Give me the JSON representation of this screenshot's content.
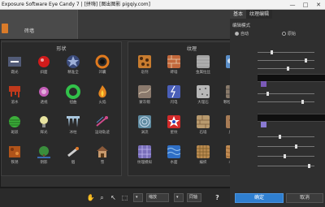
{
  "window": {
    "title": "Exposure Software Eye Candy 7 | [拼嗨] [图出图影 pigqiy.com]",
    "controls": [
      "—",
      "□",
      "✕"
    ]
  },
  "strip": {
    "label": "砖墙"
  },
  "left_panel": {
    "title": "形状",
    "items": [
      {
        "label": "霜光",
        "icon": "glow-icon",
        "color": "#7a8cc4"
      },
      {
        "label": "斜面",
        "icon": "sphere-icon",
        "color": "#d21b1b"
      },
      {
        "label": "精准全",
        "icon": "star-icon",
        "color": "#9eb0d8"
      },
      {
        "label": "凹囊",
        "icon": "ring-icon",
        "color": "#e07a1e"
      },
      {
        "label": "溶水",
        "icon": "drip-icon",
        "color": "#c0391b"
      },
      {
        "label": "透视",
        "icon": "burst-icon",
        "color": "#c35db7"
      },
      {
        "label": "扭曲",
        "icon": "donut-icon",
        "color": "#32c24a"
      },
      {
        "label": "火焰",
        "icon": "fire-icon",
        "color": "#e6861f"
      },
      {
        "label": "斑驳",
        "icon": "stripe-ball-icon",
        "color": "#3cae3a"
      },
      {
        "label": "辉光",
        "icon": "bulb-icon",
        "color": "#e8e3a0"
      },
      {
        "label": "冰柱",
        "icon": "icicle-icon",
        "color": "#a9c7de"
      },
      {
        "label": "运动轨迹",
        "icon": "trail-icon",
        "color": "#d04a8a"
      },
      {
        "label": "铁锈",
        "icon": "rust-icon",
        "color": "#b0541a"
      },
      {
        "label": "阴影",
        "icon": "tree-icon",
        "color": "#3a8e3c"
      },
      {
        "label": "烟",
        "icon": "smoke-icon",
        "color": "#cfcfcf"
      },
      {
        "label": "雪",
        "icon": "house-icon",
        "color": "#c99a6d"
      }
    ]
  },
  "right_panel": {
    "title": "纹理",
    "items": [
      {
        "label": "皂剂",
        "icon": "leopard-texture-icon",
        "color": "#c87c2f"
      },
      {
        "label": "砖墙",
        "icon": "brick-texture-icon",
        "color": "#c2683c"
      },
      {
        "label": "金属拉丝",
        "icon": "metal-texture-icon",
        "color": "#a3a3a3"
      },
      {
        "label": "云",
        "icon": "cloud-texture-icon",
        "color": "#5b8fc9"
      },
      {
        "label": "蒙灰帽",
        "icon": "marble-texture-icon",
        "color": "#8b7a6d"
      },
      {
        "label": "闪电",
        "icon": "lightning-texture-icon",
        "color": "#4a5fb8"
      },
      {
        "label": "大理石",
        "icon": "granite-texture-icon",
        "color": "#b7b7b7"
      },
      {
        "label": "颗粒切割纹理",
        "icon": "cell-texture-icon",
        "color": "#8a7b6b"
      },
      {
        "label": "涡流",
        "icon": "swirl-texture-icon",
        "color": "#5e8aa0"
      },
      {
        "label": "星纹",
        "icon": "starburst-texture-icon",
        "color": "#d22a2a"
      },
      {
        "label": "石墙",
        "icon": "stone-texture-icon",
        "color": "#b89a6e"
      },
      {
        "label": "皮肤",
        "icon": "skin-texture-icon",
        "color": "#a77b55"
      },
      {
        "label": "纹理模拟",
        "icon": "grid-texture-icon",
        "color": "#7a6fbb"
      },
      {
        "label": "水面",
        "icon": "water-texture-icon",
        "color": "#2f6fc6"
      },
      {
        "label": "编织",
        "icon": "weave-texture-icon",
        "color": "#b98a4f"
      },
      {
        "label": "木纹",
        "icon": "wood-texture-icon",
        "color": "#c08a52"
      }
    ]
  },
  "toolbar": {
    "zoom": "缩放",
    "view": "同轴",
    "help": "?"
  },
  "settings": {
    "tabs": [
      "基本",
      "纹理编辑"
    ],
    "section": "编辑模式",
    "radio1": "自动",
    "radio2": "原始"
  },
  "buttons": {
    "ok": "确定",
    "cancel": "取消"
  }
}
